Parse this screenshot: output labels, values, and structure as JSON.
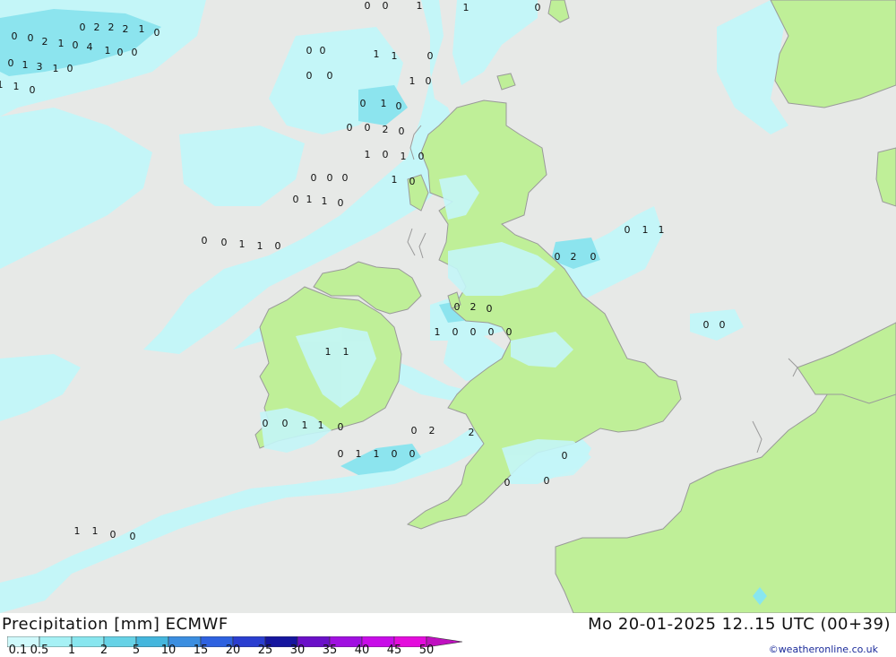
{
  "header": {
    "title": "Precipitation [mm] ECMWF",
    "valid_time": "Mo 20-01-2025 12..15 UTC (00+39)"
  },
  "legend": {
    "labels": [
      "0.1",
      "0.5",
      "1",
      "2",
      "5",
      "10",
      "15",
      "20",
      "25",
      "30",
      "35",
      "40",
      "45",
      "50"
    ],
    "colors": [
      "#cff9fb",
      "#a6f1f5",
      "#88e6ef",
      "#66d2e6",
      "#44b6dd",
      "#3b8ee0",
      "#2e62e0",
      "#2a3ed0",
      "#15159e",
      "#6a10c8",
      "#a010e0",
      "#c80ce8",
      "#e40cdc",
      "#c010c0"
    ]
  },
  "credit": "©weatheronline.co.uk",
  "colors": {
    "sea": "#e7e9e7",
    "land": "#bfef98",
    "precip_light": "#c4f6f8",
    "precip_med": "#8ce4ee",
    "coast": "#9a9a9a"
  },
  "map_values": [
    {
      "v": "0"
    },
    {
      "v": "0"
    },
    {
      "v": "1"
    },
    {
      "v": "1"
    },
    {
      "v": "0"
    },
    {
      "v": "0"
    },
    {
      "v": "2"
    },
    {
      "v": "2"
    },
    {
      "v": "2"
    },
    {
      "v": "1"
    },
    {
      "v": "0"
    },
    {
      "v": "0"
    },
    {
      "v": "0"
    },
    {
      "v": "2"
    },
    {
      "v": "1"
    },
    {
      "v": "0"
    },
    {
      "v": "4"
    },
    {
      "v": "1"
    },
    {
      "v": "0"
    },
    {
      "v": "0"
    },
    {
      "v": "0"
    },
    {
      "v": "1"
    },
    {
      "v": "3"
    },
    {
      "v": "1"
    },
    {
      "v": "0"
    },
    {
      "v": "1"
    },
    {
      "v": "1"
    },
    {
      "v": "0"
    },
    {
      "v": "0"
    },
    {
      "v": "0"
    },
    {
      "v": "1"
    },
    {
      "v": "1"
    },
    {
      "v": "0"
    },
    {
      "v": "0"
    },
    {
      "v": "0"
    },
    {
      "v": "1"
    },
    {
      "v": "0"
    },
    {
      "v": "0"
    },
    {
      "v": "1"
    },
    {
      "v": "0"
    },
    {
      "v": "0"
    },
    {
      "v": "0"
    },
    {
      "v": "2"
    },
    {
      "v": "0"
    },
    {
      "v": "1"
    },
    {
      "v": "0"
    },
    {
      "v": "1"
    },
    {
      "v": "0"
    },
    {
      "v": "0"
    },
    {
      "v": "0"
    },
    {
      "v": "0"
    },
    {
      "v": "1"
    },
    {
      "v": "0"
    },
    {
      "v": "0"
    },
    {
      "v": "1"
    },
    {
      "v": "1"
    },
    {
      "v": "0"
    },
    {
      "v": "0"
    },
    {
      "v": "0"
    },
    {
      "v": "1"
    },
    {
      "v": "1"
    },
    {
      "v": "0"
    },
    {
      "v": "0"
    },
    {
      "v": "2"
    },
    {
      "v": "0"
    },
    {
      "v": "0"
    },
    {
      "v": "2"
    },
    {
      "v": "0"
    },
    {
      "v": "1"
    },
    {
      "v": "0"
    },
    {
      "v": "0"
    },
    {
      "v": "0"
    },
    {
      "v": "0"
    },
    {
      "v": "0"
    },
    {
      "v": "1"
    },
    {
      "v": "1"
    },
    {
      "v": "0"
    },
    {
      "v": "0"
    },
    {
      "v": "0"
    },
    {
      "v": "2"
    },
    {
      "v": "2"
    },
    {
      "v": "0"
    },
    {
      "v": "0"
    },
    {
      "v": "1"
    },
    {
      "v": "1"
    },
    {
      "v": "0"
    },
    {
      "v": "1"
    },
    {
      "v": "1"
    },
    {
      "v": "0"
    },
    {
      "v": "0"
    },
    {
      "v": "1"
    },
    {
      "v": "1"
    },
    {
      "v": "0"
    },
    {
      "v": "0"
    },
    {
      "v": "0"
    },
    {
      "v": "0"
    },
    {
      "v": "1"
    },
    {
      "v": "1"
    },
    {
      "v": "0"
    },
    {
      "v": "0"
    },
    {
      "v": "0"
    },
    {
      "v": "0"
    },
    {
      "v": "1"
    },
    {
      "v": "0"
    },
    {
      "v": "0"
    },
    {
      "v": "0"
    },
    {
      "v": "0"
    },
    {
      "v": "0"
    },
    {
      "v": "0"
    },
    {
      "v": "0"
    }
  ]
}
